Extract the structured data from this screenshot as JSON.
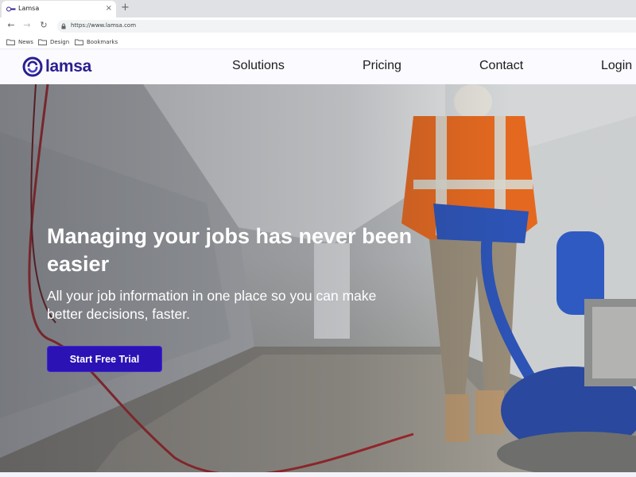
{
  "browser": {
    "tab_title": "Lamsa",
    "tab_close": "×",
    "new_tab": "+",
    "url": "https://www.lamsa.com",
    "back": "←",
    "forward": "→",
    "reload": "↻",
    "bookmarks": [
      {
        "label": "News"
      },
      {
        "label": "Design"
      },
      {
        "label": "Bookmarks"
      }
    ]
  },
  "site": {
    "brand_name": "lamsa",
    "brand_color": "#2a1f8f",
    "nav": [
      {
        "label": "Solutions"
      },
      {
        "label": "Pricing"
      },
      {
        "label": "Contact"
      },
      {
        "label": "Login"
      }
    ]
  },
  "hero": {
    "title": "Managing your jobs has never been easier",
    "subtitle": "All your job information in one place so you can make better decisions, faster.",
    "cta_label": "Start Free Trial",
    "cta_color": "#2b12b5"
  },
  "icons": {
    "favicon": "lamsa-logo-icon",
    "lock": "lock-icon",
    "folder": "folder-icon"
  }
}
